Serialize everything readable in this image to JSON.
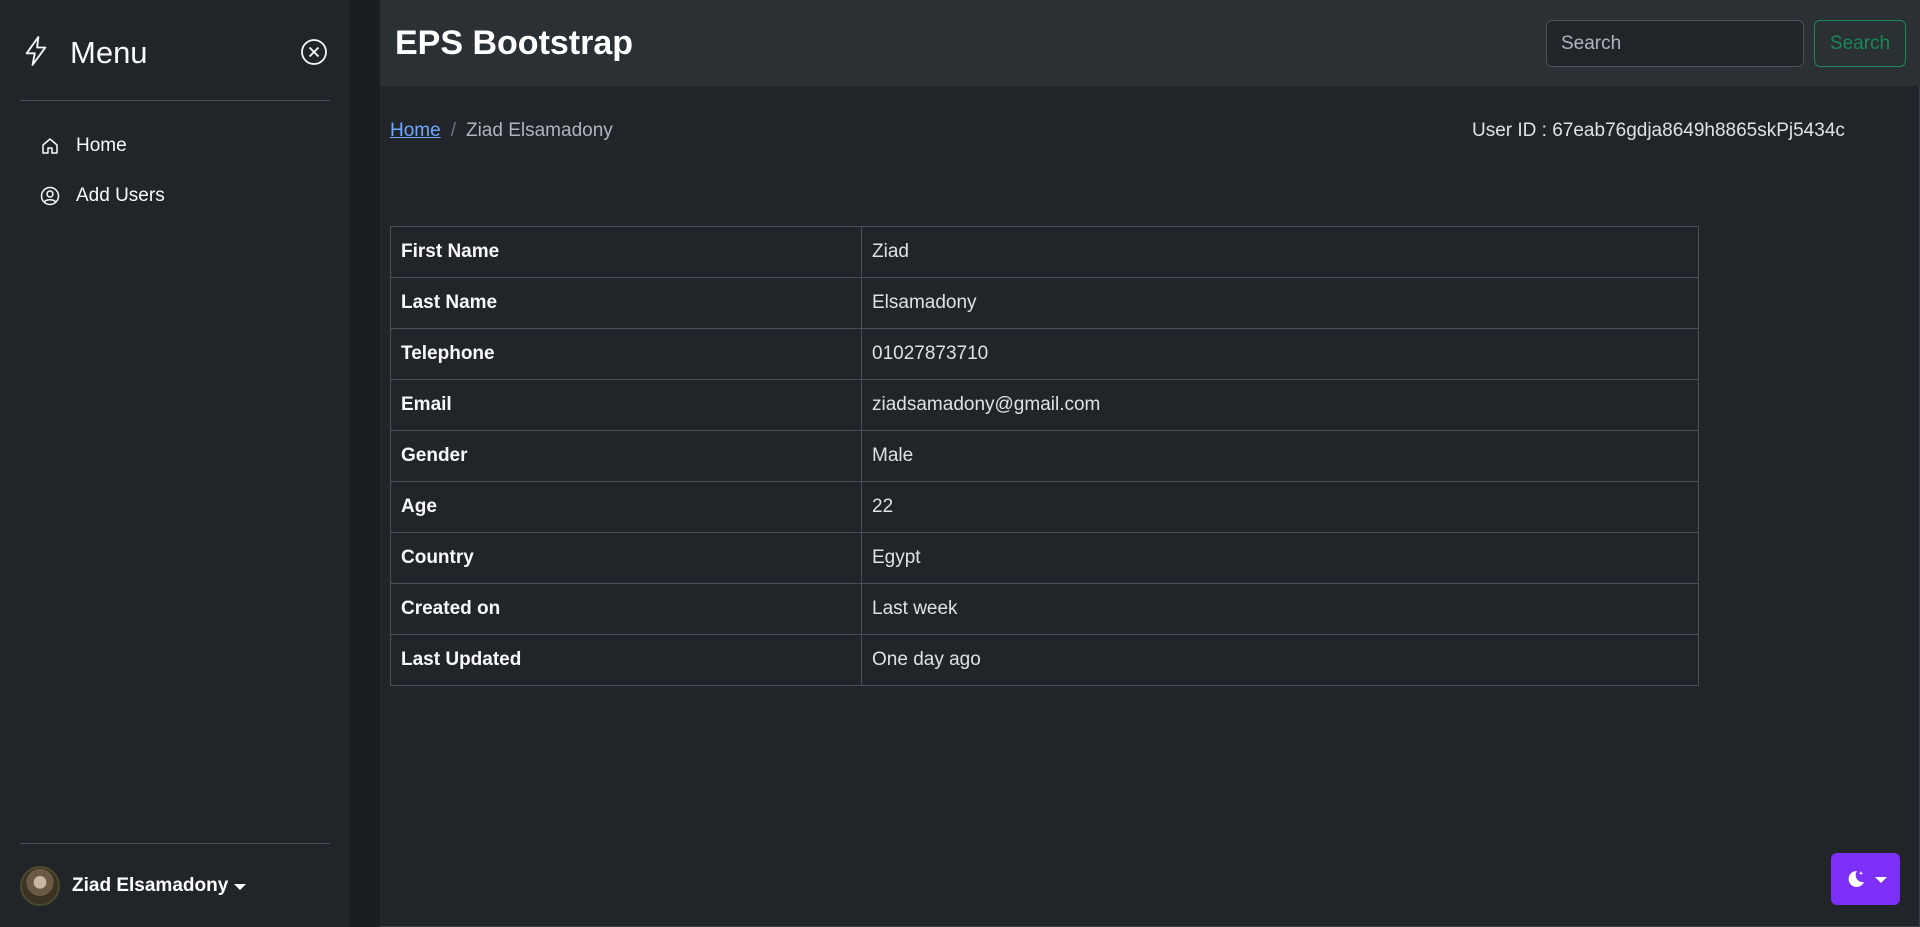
{
  "sidebar": {
    "title": "Menu",
    "items": [
      {
        "label": "Home",
        "icon": "home-icon"
      },
      {
        "label": "Add Users",
        "icon": "user-circle-icon"
      }
    ],
    "user": {
      "name": "Ziad Elsamadony"
    }
  },
  "header": {
    "brand": "EPS Bootstrap",
    "search_placeholder": "Search",
    "search_button": "Search"
  },
  "breadcrumb": {
    "home": "Home",
    "separator": "/",
    "current": "Ziad Elsamadony"
  },
  "user_id": "User ID : 67eab76gdja8649h8865skPj5434c",
  "details": [
    {
      "key": "First Name",
      "value": "Ziad"
    },
    {
      "key": "Last Name",
      "value": "Elsamadony"
    },
    {
      "key": "Telephone",
      "value": "01027873710"
    },
    {
      "key": "Email",
      "value": "ziadsamadony@gmail.com"
    },
    {
      "key": "Gender",
      "value": "Male"
    },
    {
      "key": "Age",
      "value": "22"
    },
    {
      "key": "Country",
      "value": "Egypt"
    },
    {
      "key": "Created on",
      "value": "Last week"
    },
    {
      "key": "Last Updated",
      "value": "One day ago"
    }
  ],
  "colors": {
    "background": "#212529",
    "header": "#2b3035",
    "link": "#6ea8fe",
    "success": "#198754",
    "theme_button": "#7b2ff7"
  }
}
